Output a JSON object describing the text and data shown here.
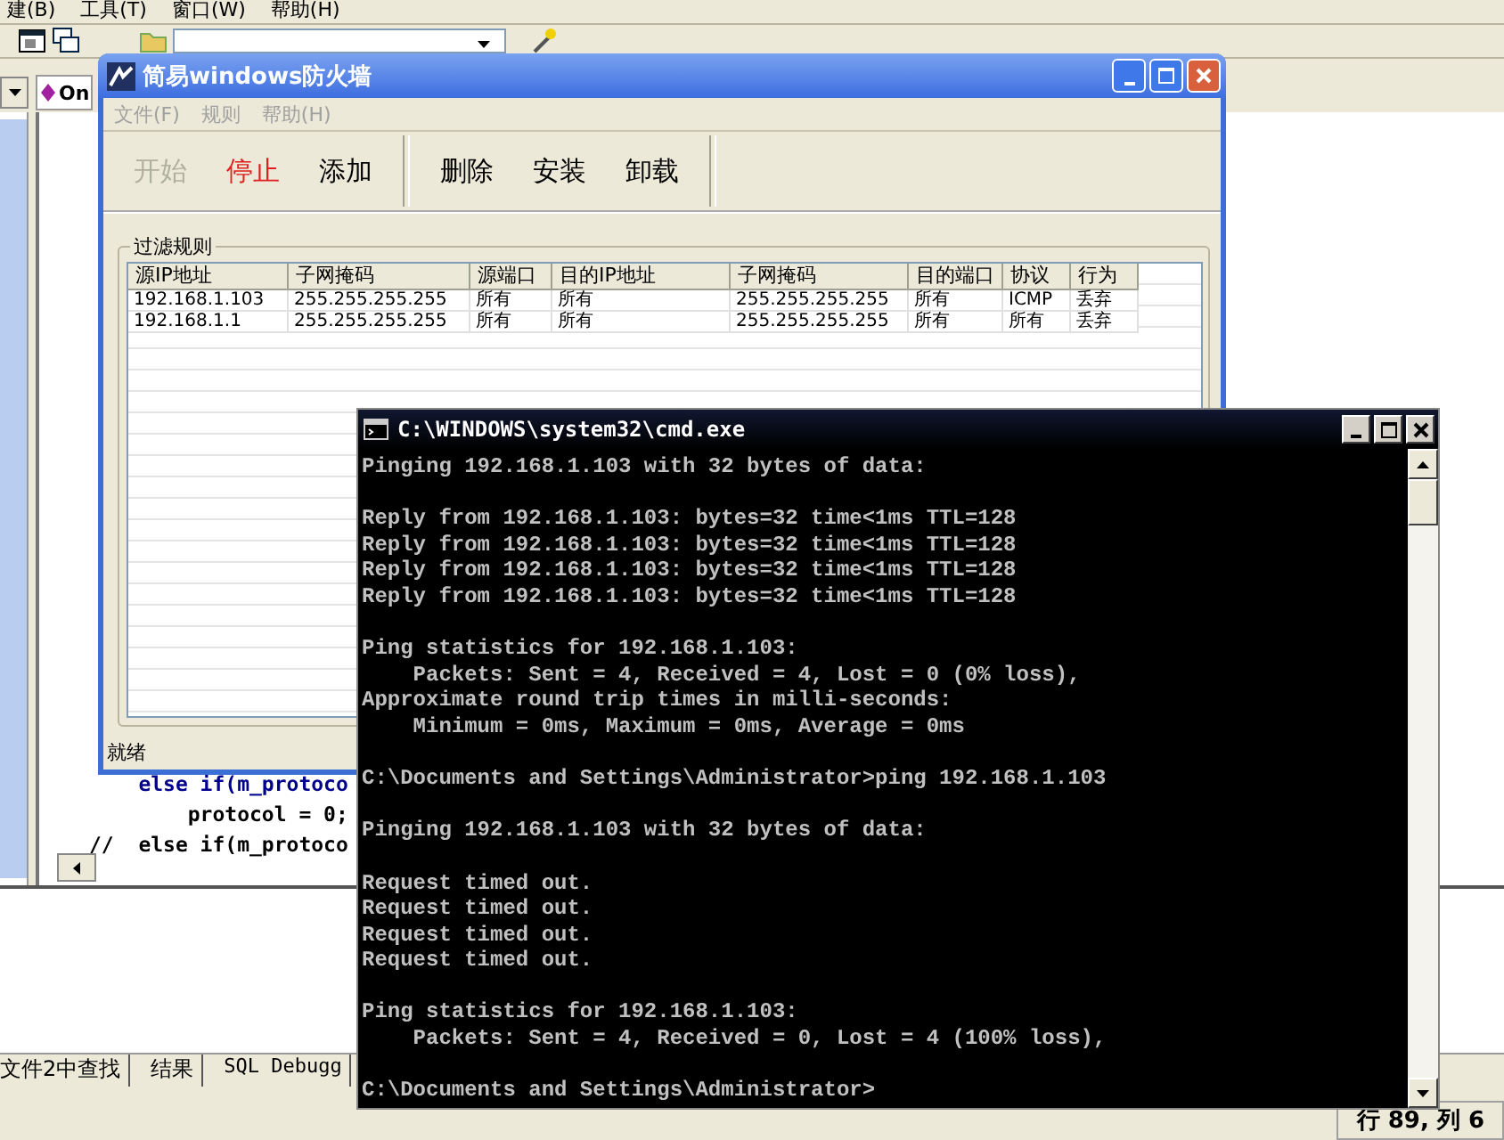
{
  "ide": {
    "menu": [
      {
        "label": "建(B)"
      },
      {
        "label": "工具(T)"
      },
      {
        "label": "窗口(W)"
      },
      {
        "label": "帮助(H)"
      }
    ],
    "tab": "On",
    "code_lines": [
      "    else if(m_protoco",
      "        protocol = 0;",
      "//  else if(m_protoco"
    ],
    "output_tabs": [
      {
        "label": "文件2中查找",
        "selected": false
      },
      {
        "label": "结果",
        "selected": false
      },
      {
        "label": "SQL Debugg",
        "selected": false
      }
    ],
    "status": "行 89, 列 6"
  },
  "firewall": {
    "title": "简易windows防火墙",
    "menu": [
      {
        "label": "文件(F)",
        "disabled": true
      },
      {
        "label": "规则",
        "disabled": true
      },
      {
        "label": "帮助(H)",
        "disabled": true
      }
    ],
    "toolbar": [
      {
        "label": "开始",
        "disabled": true,
        "active": false,
        "separator_before": false
      },
      {
        "label": "停止",
        "disabled": false,
        "active": true,
        "separator_before": false
      },
      {
        "label": "添加",
        "disabled": false,
        "active": false,
        "separator_before": false
      },
      {
        "label": "删除",
        "disabled": false,
        "active": false,
        "separator_before": true
      },
      {
        "label": "安装",
        "disabled": false,
        "active": false,
        "separator_before": false
      },
      {
        "label": "卸载",
        "disabled": false,
        "active": false,
        "separator_before": false
      }
    ],
    "group_title": "过滤规则",
    "columns": [
      "源IP地址",
      "子网掩码",
      "源端口",
      "目的IP地址",
      "子网掩码",
      "目的端口",
      "协议",
      "行为"
    ],
    "rows": [
      [
        "192.168.1.103",
        "255.255.255.255",
        "所有",
        "所有",
        "255.255.255.255",
        "所有",
        "ICMP",
        "丢弃"
      ],
      [
        "192.168.1.1",
        "255.255.255.255",
        "所有",
        "所有",
        "255.255.255.255",
        "所有",
        "所有",
        "丢弃"
      ]
    ],
    "status": "就绪"
  },
  "cmd": {
    "title": "C:\\WINDOWS\\system32\\cmd.exe",
    "blocks": [
      [
        "Pinging 192.168.1.103 with 32 bytes of data:"
      ],
      [
        "Reply from 192.168.1.103: bytes=32 time<1ms TTL=128",
        "Reply from 192.168.1.103: bytes=32 time<1ms TTL=128",
        "Reply from 192.168.1.103: bytes=32 time<1ms TTL=128",
        "Reply from 192.168.1.103: bytes=32 time<1ms TTL=128"
      ],
      [
        "Ping statistics for 192.168.1.103:",
        "    Packets: Sent = 4, Received = 4, Lost = 0 (0% loss),",
        "Approximate round trip times in milli-seconds:",
        "    Minimum = 0ms, Maximum = 0ms, Average = 0ms"
      ],
      [
        "C:\\Documents and Settings\\Administrator>ping 192.168.1.103"
      ],
      [
        "Pinging 192.168.1.103 with 32 bytes of data:"
      ],
      [
        "Request timed out.",
        "Request timed out.",
        "Request timed out.",
        "Request timed out."
      ],
      [
        "Ping statistics for 192.168.1.103:",
        "    Packets: Sent = 4, Received = 0, Lost = 4 (100% loss),"
      ],
      [
        "C:\\Documents and Settings\\Administrator>"
      ]
    ]
  }
}
